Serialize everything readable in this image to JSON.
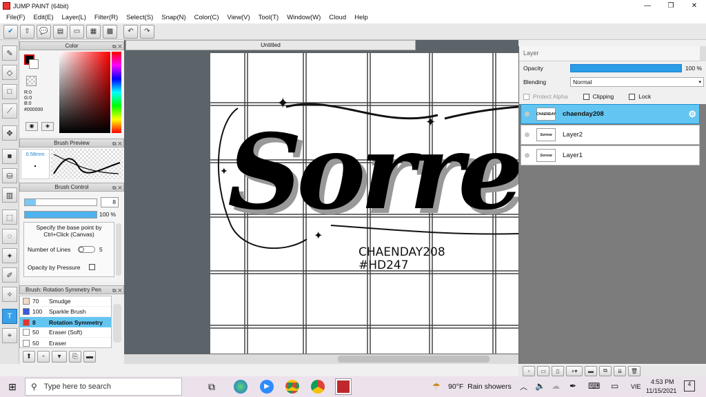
{
  "window": {
    "title": "JUMP PAINT (64bit)"
  },
  "menu": [
    "File(F)",
    "Edit(E)",
    "Layer(L)",
    "Filter(R)",
    "Select(S)",
    "Snap(N)",
    "Color(C)",
    "View(V)",
    "Tool(T)",
    "Window(W)",
    "Cloud",
    "Help"
  ],
  "color_panel": {
    "title": "Color",
    "r": "R:0",
    "g": "G:0",
    "b": "B:0",
    "hex": "#000000",
    "current_color": "#000000"
  },
  "brush_preview": {
    "title": "Brush Preview",
    "size": "0.58mm"
  },
  "brush_control": {
    "title": "Brush Control",
    "size_value": "8",
    "opacity_value": "100 %",
    "hint": "Specify the base point by Ctrl+Click (Canvas)",
    "lines_label": "Number of Lines",
    "lines_value": "5",
    "pressure_label": "Opacity by Pressure"
  },
  "brush_list": {
    "title": "Brush: Rotation Symmetry Pen",
    "items": [
      {
        "size": "70",
        "name": "Smudge",
        "color": "#f3d9c6"
      },
      {
        "size": "100",
        "name": "Sparkle Brush",
        "color": "#3b5bdc"
      },
      {
        "size": "8",
        "name": "Rotation Symmetry",
        "color": "#e8332c"
      },
      {
        "size": "50",
        "name": "Eraser (Soft)",
        "color": "#ffffff"
      },
      {
        "size": "50",
        "name": "Eraser",
        "color": "#ffffff"
      }
    ]
  },
  "document": {
    "tab": "Untitled",
    "text_line1": "CHAENDAY208",
    "text_line2": "#HD247",
    "script_word": "Sorre"
  },
  "layer_panel": {
    "title": "Layer",
    "opacity_label": "Opacity",
    "opacity_value": "100 %",
    "blending_label": "Blending",
    "blending_value": "Normal",
    "protect_alpha": "Protect Alpha",
    "clipping": "Clipping",
    "lock": "Lock",
    "layers": [
      {
        "name": "chaenday208",
        "thumb": "CHAENDAY"
      },
      {
        "name": "Layer2",
        "thumb": "Sorrow"
      },
      {
        "name": "Layer1",
        "thumb": "Sorrow"
      }
    ]
  },
  "taskbar": {
    "search_placeholder": "Type here to search",
    "weather": "90°F  Rain showers",
    "lang": "VIE",
    "time": "4:53 PM",
    "date": "11/15/2021",
    "notif_count": "4"
  }
}
